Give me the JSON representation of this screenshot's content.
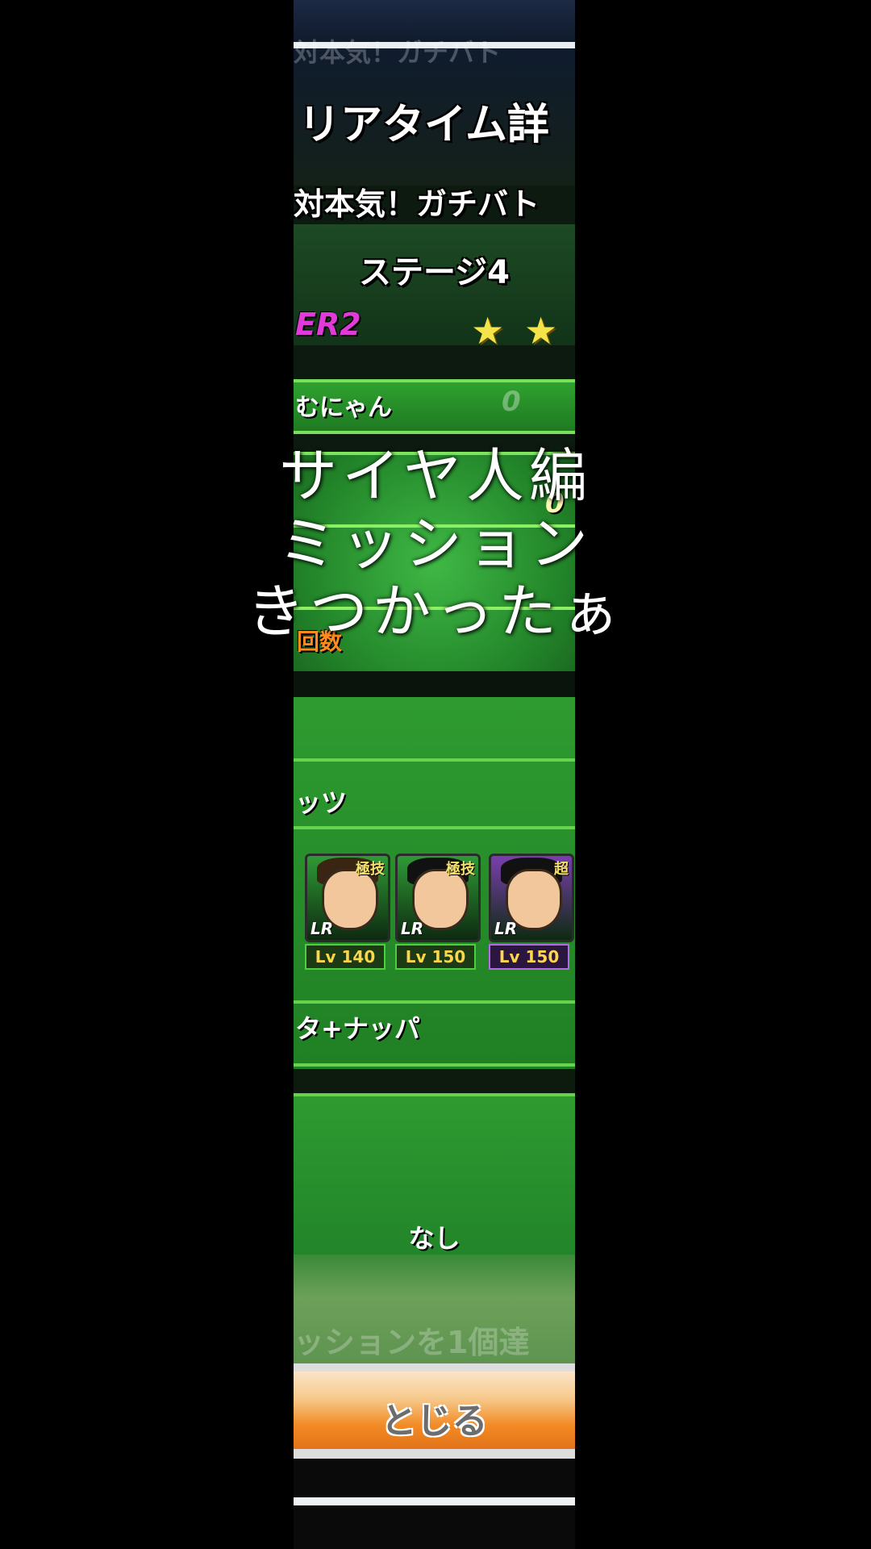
{
  "header": {
    "ghost_text": "対本気！ガチバト",
    "title": "リアタイム詳",
    "subtitle": "対本気！ガチバト",
    "stage": "ステージ4",
    "difficulty": "ER2",
    "stars": 2
  },
  "player": {
    "name": "むにゃん",
    "ghost_digit": "0",
    "ghost_digit2": "0"
  },
  "battle": {
    "count_label": "回数"
  },
  "team": {
    "name": "ッツ",
    "characters": [
      {
        "skill": "極技",
        "rarity": "LR",
        "level": "Lv 140",
        "hair": "#3a2412",
        "frame": "#2f9a36"
      },
      {
        "skill": "極技",
        "rarity": "LR",
        "level": "Lv 150",
        "hair": "#111111",
        "frame": "#2f9a36"
      },
      {
        "skill": "超",
        "rarity": "LR",
        "level": "Lv 150",
        "hair": "#111111",
        "frame": "#7a3fae"
      }
    ],
    "name2": "タ+ナッパ"
  },
  "support": {
    "none": "なし"
  },
  "mission": {
    "ghost": "ッションを1個達"
  },
  "buttons": {
    "close": "とじる"
  },
  "overlay": {
    "line1": "サイヤ人編",
    "line2": "ミッション",
    "line3": "きつかったぁ"
  }
}
